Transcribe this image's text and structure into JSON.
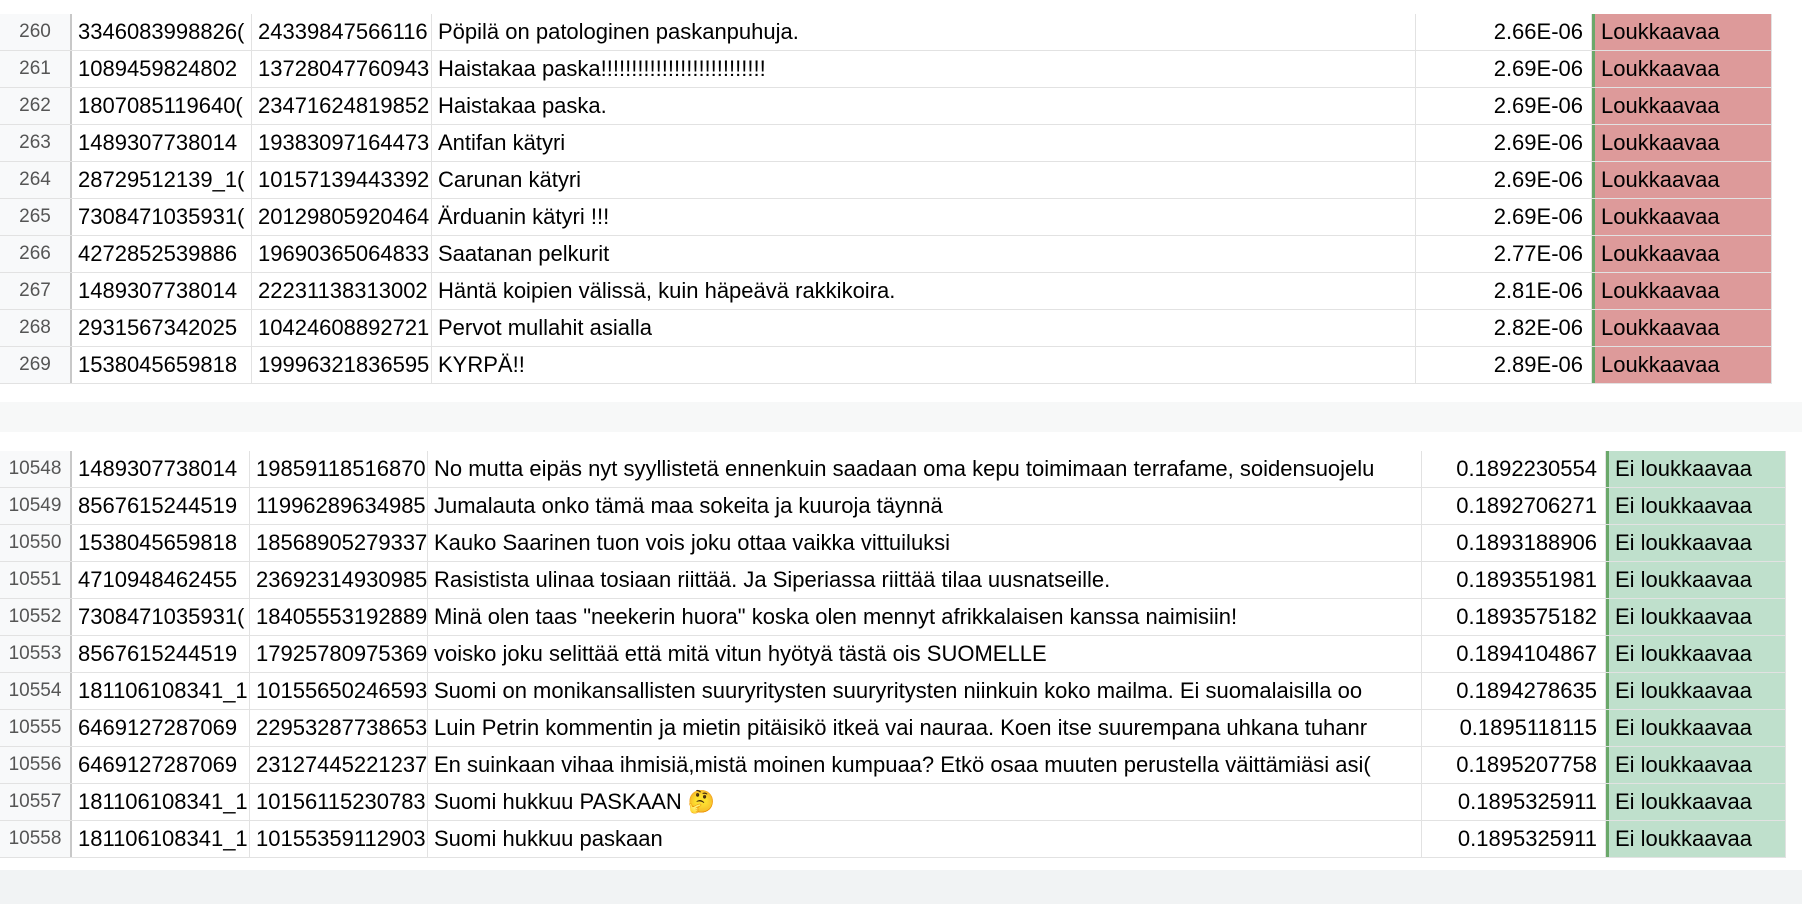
{
  "top_sheet": {
    "rows": [
      {
        "num": "260",
        "id1": "3346083998826(",
        "id2": "24339847566116",
        "text": "Pöpilä on patologinen paskanpuhuja.",
        "score": "2.66E-06",
        "label": "Loukkaavaa"
      },
      {
        "num": "261",
        "id1": "1089459824802",
        "id2": "13728047760943",
        "text": "Haistakaa paska!!!!!!!!!!!!!!!!!!!!!!!!!!!",
        "score": "2.69E-06",
        "label": "Loukkaavaa"
      },
      {
        "num": "262",
        "id1": "1807085119640(",
        "id2": "23471624819852",
        "text": "Haistakaa paska.",
        "score": "2.69E-06",
        "label": "Loukkaavaa"
      },
      {
        "num": "263",
        "id1": "1489307738014",
        "id2": "19383097164473",
        "text": "Antifan kätyri",
        "score": "2.69E-06",
        "label": "Loukkaavaa"
      },
      {
        "num": "264",
        "id1": "28729512139_1(",
        "id2": "10157139443392",
        "text": "Carunan kätyri",
        "score": "2.69E-06",
        "label": "Loukkaavaa"
      },
      {
        "num": "265",
        "id1": "7308471035931(",
        "id2": "20129805920464",
        "text": "Ärduanin kätyri !!!",
        "score": "2.69E-06",
        "label": "Loukkaavaa"
      },
      {
        "num": "266",
        "id1": "4272852539886",
        "id2": "19690365064833",
        "text": "Saatanan pelkurit",
        "score": "2.77E-06",
        "label": "Loukkaavaa"
      },
      {
        "num": "267",
        "id1": "1489307738014",
        "id2": "22231138313002",
        "text": "Häntä koipien välissä, kuin häpeävä rakkikoira.",
        "score": "2.81E-06",
        "label": "Loukkaavaa"
      },
      {
        "num": "268",
        "id1": "2931567342025",
        "id2": "10424608892721",
        "text": "Pervot mullahit asialla",
        "score": "2.82E-06",
        "label": "Loukkaavaa"
      },
      {
        "num": "269",
        "id1": "1538045659818",
        "id2": "19996321836595",
        "text": "KYRPÄ!!",
        "score": "2.89E-06",
        "label": "Loukkaavaa"
      }
    ]
  },
  "bottom_sheet": {
    "rows": [
      {
        "num": "10548",
        "id1": "1489307738014",
        "id2": "19859118516870",
        "text": "No mutta eipäs nyt syyllistetä ennenkuin saadaan oma kepu toimimaan terrafame, soidensuojelu",
        "score": "0.1892230554",
        "label": "Ei loukkaavaa"
      },
      {
        "num": "10549",
        "id1": "8567615244519",
        "id2": "11996289634985",
        "text": "Jumalauta onko tämä maa sokeita ja kuuroja täynnä",
        "score": "0.1892706271",
        "label": "Ei loukkaavaa"
      },
      {
        "num": "10550",
        "id1": "1538045659818",
        "id2": "18568905279337",
        "text": "Kauko Saarinen tuon vois joku ottaa vaikka vittuiluksi",
        "score": "0.1893188906",
        "label": "Ei loukkaavaa"
      },
      {
        "num": "10551",
        "id1": "4710948462455",
        "id2": "23692314930985",
        "text": "Rasistista ulinaa tosiaan riittää. Ja Siperiassa riittää tilaa uusnatseille.",
        "score": "0.1893551981",
        "label": "Ei loukkaavaa"
      },
      {
        "num": "10552",
        "id1": "7308471035931(",
        "id2": "18405553192889",
        "text": "Minä olen taas \"neekerin huora\" koska olen mennyt afrikkalaisen kanssa naimisiin!",
        "score": "0.1893575182",
        "label": "Ei loukkaavaa"
      },
      {
        "num": "10553",
        "id1": "8567615244519",
        "id2": "17925780975369",
        "text": "voisko joku selittää että mitä vitun hyötyä tästä ois SUOMELLE",
        "score": "0.1894104867",
        "label": "Ei loukkaavaa"
      },
      {
        "num": "10554",
        "id1": "181106108341_1",
        "id2": "10155650246593",
        "text": "Suomi on monikansallisten suuryritysten suuryritysten niinkuin koko mailma. Ei suomalaisilla oo",
        "score": "0.1894278635",
        "label": "Ei loukkaavaa"
      },
      {
        "num": "10555",
        "id1": "6469127287069",
        "id2": "22953287738653",
        "text": "Luin Petrin kommentin ja mietin pitäisikö itkeä vai nauraa. Koen itse suurempana uhkana tuhanr",
        "score": "0.1895118115",
        "label": "Ei loukkaavaa"
      },
      {
        "num": "10556",
        "id1": "6469127287069",
        "id2": "23127445221237",
        "text": "En suinkaan vihaa ihmisiä,mistä moinen kumpuaa? Etkö osaa muuten perustella väittämiäsi asi(",
        "score": "0.1895207758",
        "label": "Ei loukkaavaa"
      },
      {
        "num": "10557",
        "id1": "181106108341_1",
        "id2": "10156115230783",
        "text": "Suomi hukkuu PASKAAN 🤔",
        "score": "0.1895325911",
        "label": "Ei loukkaavaa"
      },
      {
        "num": "10558",
        "id1": "181106108341_1",
        "id2": "10155359112903",
        "text": "Suomi hukkuu paskaan",
        "score": "0.1895325911",
        "label": "Ei loukkaavaa"
      }
    ]
  }
}
